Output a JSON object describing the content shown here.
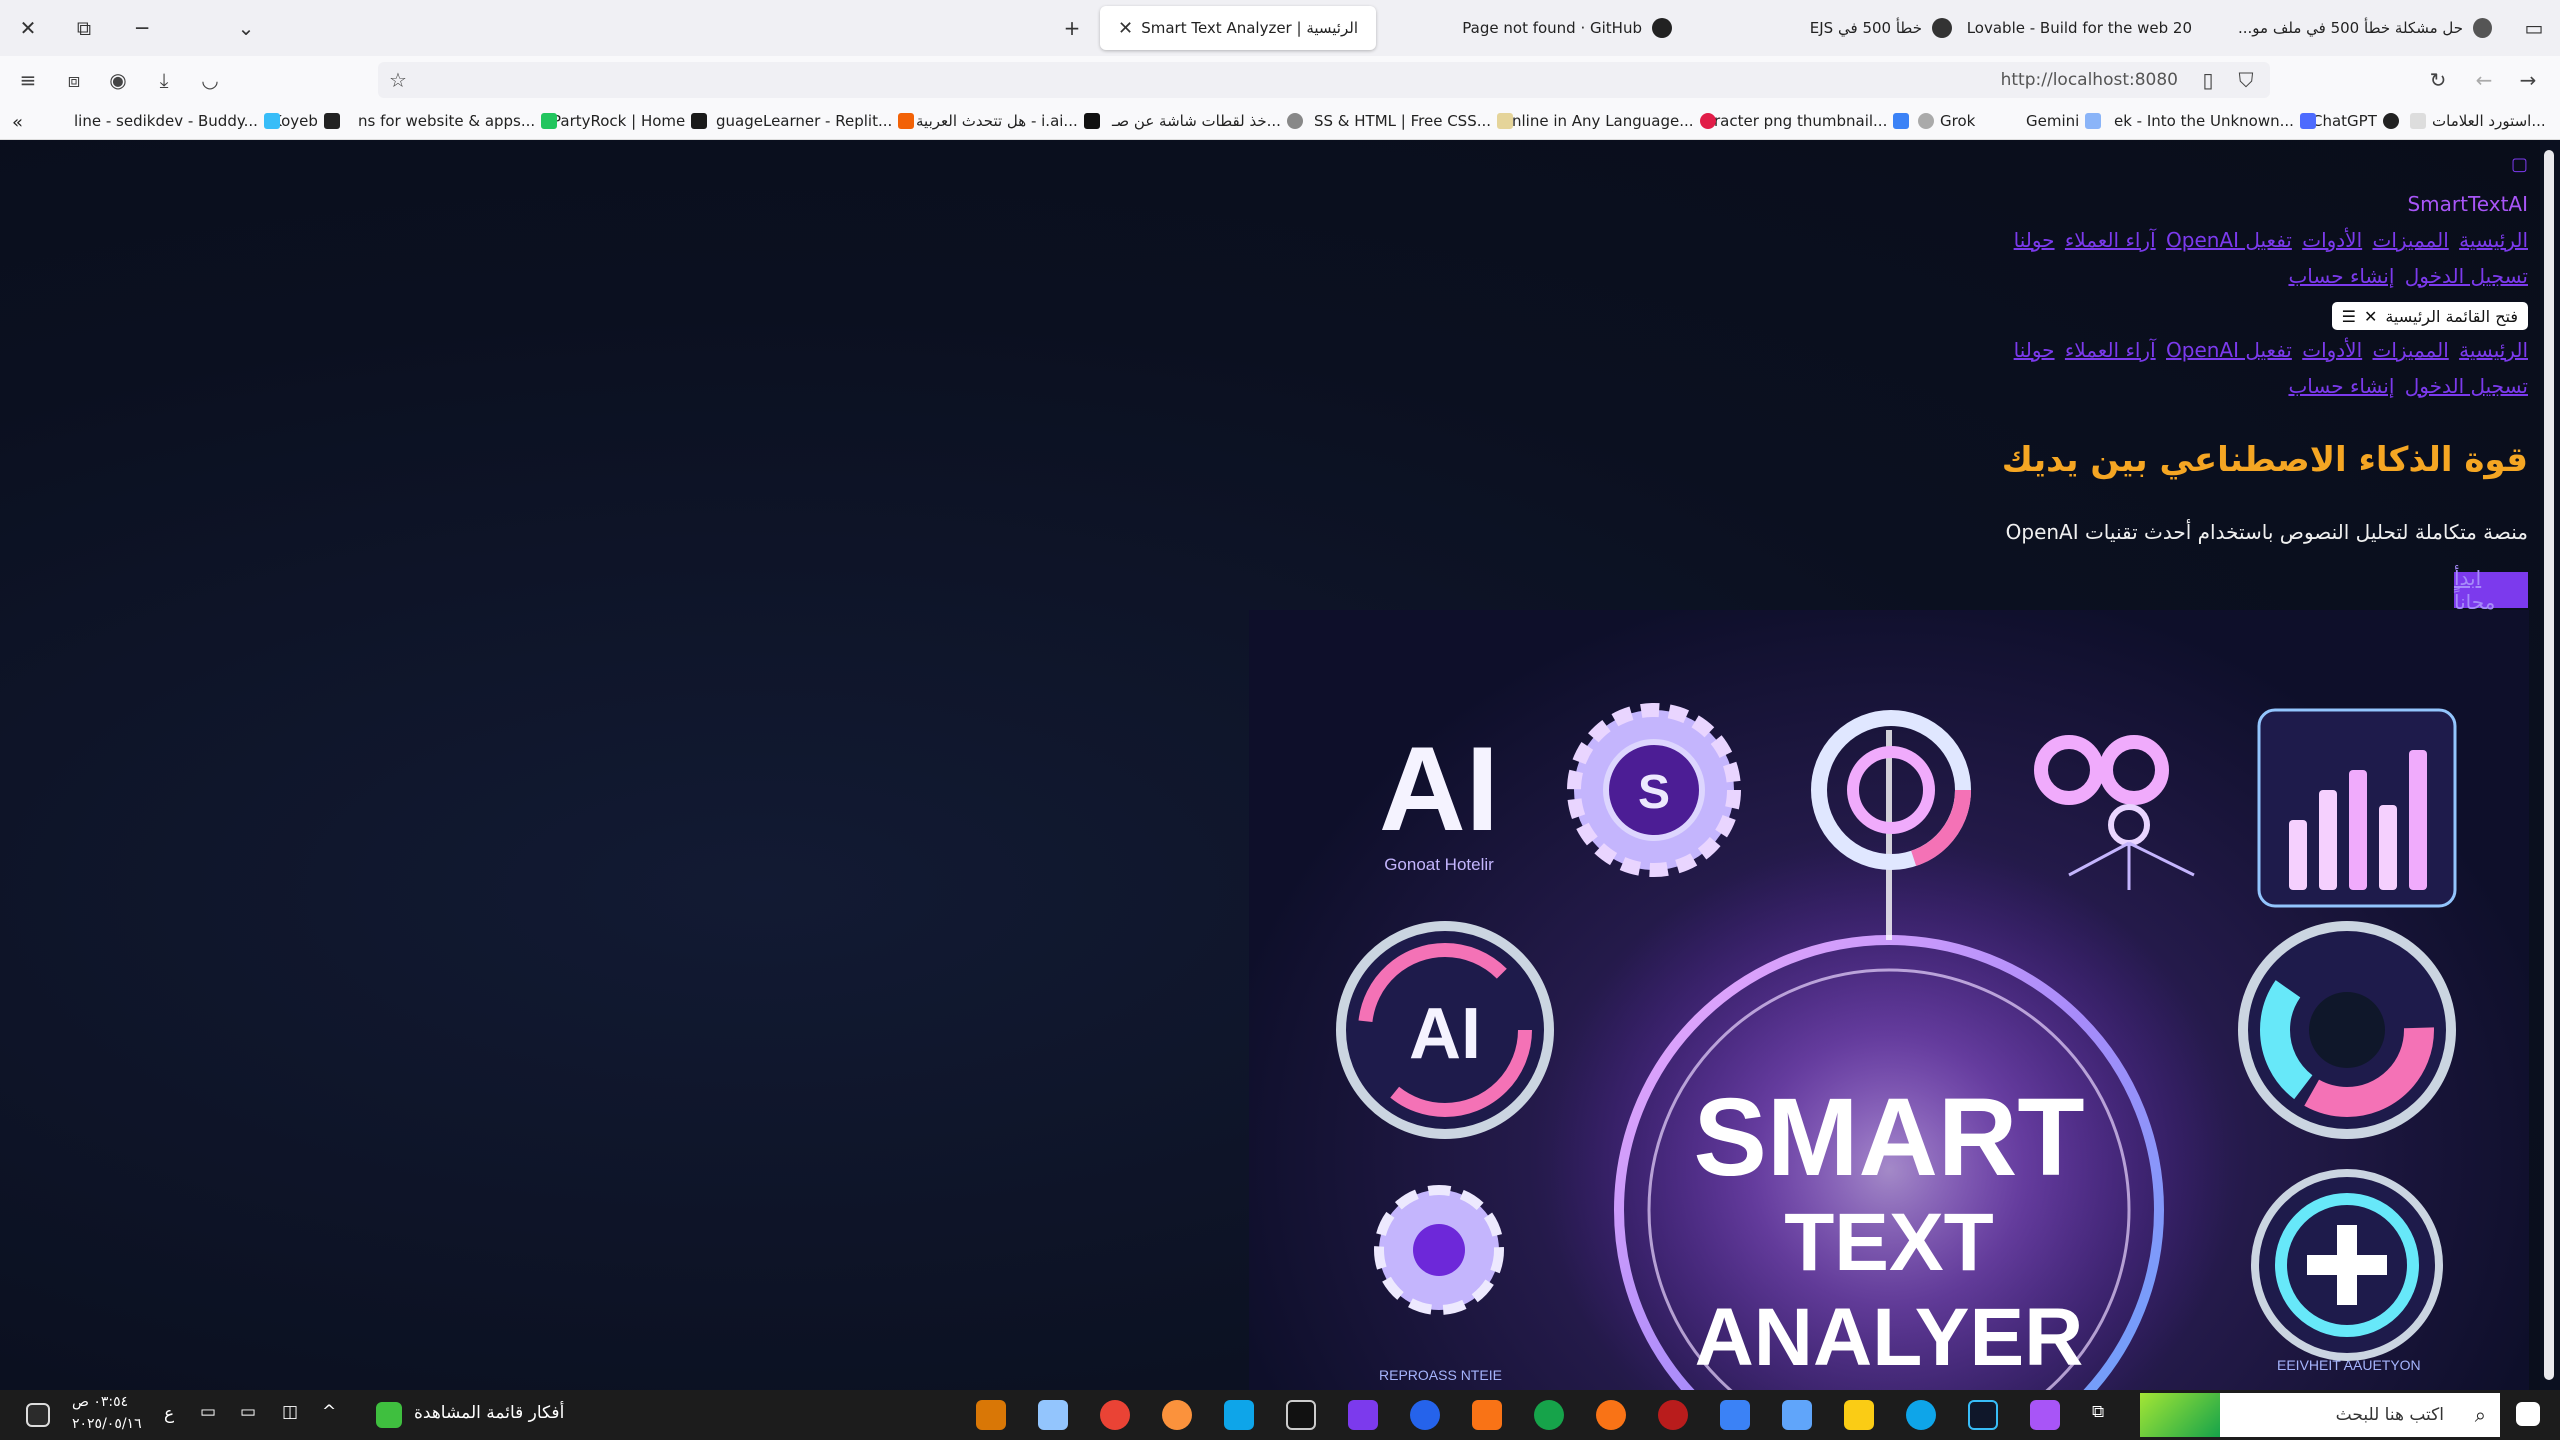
{
  "browser": {
    "tabs": [
      {
        "title": "حل مشكلة خطأ 500 في ملف مو...",
        "active": false
      },
      {
        "title": "Lovable - Build for the web 20",
        "active": false
      },
      {
        "title": "خطأ 500 في EJS",
        "active": false
      },
      {
        "title": "Page not found · GitHub",
        "active": false
      },
      {
        "title": "الرئيسية | Smart Text Analyzer",
        "active": true
      }
    ],
    "new_tab_label": "+",
    "url": "http://localhost:8080",
    "bookmarks": [
      "استورد العلامات...",
      "ChatGPT",
      "ek - Into the Unknown...",
      "Gemini",
      "Grok",
      "racter png thumbnail...",
      "nline in Any Language...",
      "SS & HTML | Free CSS...",
      "خذ لقطات شاشة عن صـ...",
      "هل تتحدث العربية - i.ai...",
      "guageLearner - Replit...",
      "PartyRock | Home",
      "ns for website & apps...",
      "Koyeb",
      "line - sedikdev - Buddy..."
    ]
  },
  "site": {
    "brand": "SmartTextAI",
    "nav_links": [
      "الرئيسية",
      "المميزات",
      "الأدوات",
      "تفعيل OpenAI",
      "آراء العملاء",
      "حولنا"
    ],
    "auth_links": [
      "تسجيل الدخول",
      "إنشاء حساب"
    ],
    "menu_button": "فتح القائمة الرئيسية",
    "hero_title": "قوة الذكاء الاصطناعي بين يديك",
    "hero_subtitle": "منصة متكاملة لتحليل النصوص باستخدام أحدث تقنيات OpenAI",
    "cta_label": "ابدأ مجاناً",
    "hero_image": {
      "line1": "SMART",
      "line2": "TEXT",
      "line3": "ANALYER",
      "badge_ai": "AI",
      "badge_caption": "Gonoat Hotelir",
      "bottom_left_caption": "REPROASS NTEIE",
      "bottom_right_caption": "EEIVHEIT AAUETYON"
    }
  },
  "taskbar": {
    "search_placeholder": "اكتب هنا للبحث",
    "pinned_label": "أفكار قائمة المشاهدة",
    "lang": "ع",
    "time": "٠٣:٥٤ ص",
    "date": "٢٠٢٥/٠٥/١٦"
  }
}
